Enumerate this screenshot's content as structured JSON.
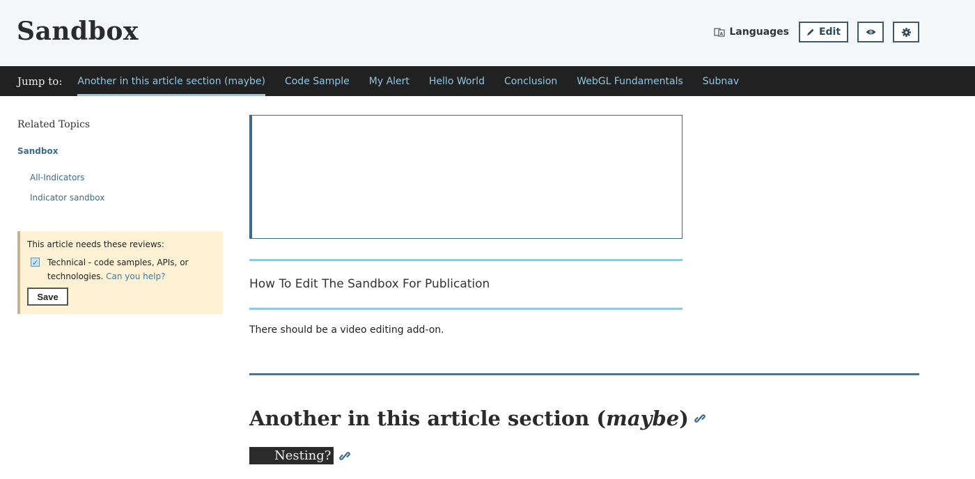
{
  "header": {
    "title": "Sandbox",
    "languages_label": "Languages",
    "edit_label": "Edit"
  },
  "jump_nav": {
    "label": "Jump to:",
    "items": [
      "Another in this article section (maybe)",
      "Code Sample",
      "My Alert",
      "Hello World",
      "Conclusion",
      "WebGL Fundamentals",
      "Subnav"
    ],
    "active_index": 0
  },
  "sidebar": {
    "related_title": "Related Topics",
    "root_link": "Sandbox",
    "sub_links": [
      "All-Indicators",
      "Indicator sandbox"
    ],
    "review": {
      "intro": "This article needs these reviews:",
      "item_text": "Technical - code samples, APIs, or technologies.",
      "help_link": "Can you help?",
      "checked": true,
      "save_label": "Save"
    }
  },
  "main": {
    "how_title": "How To Edit The Sandbox For Publication",
    "body_text": "There should be a video editing add-on.",
    "section_heading_prefix": "Another in this article section (",
    "section_heading_em": "maybe",
    "section_heading_suffix": ")",
    "nesting_label": "Nesting?"
  },
  "colors": {
    "accent_link": "#3a6b8b",
    "nav_link": "#8ec8e4",
    "nav_bg": "#212121",
    "review_bg": "#fff1d3"
  }
}
